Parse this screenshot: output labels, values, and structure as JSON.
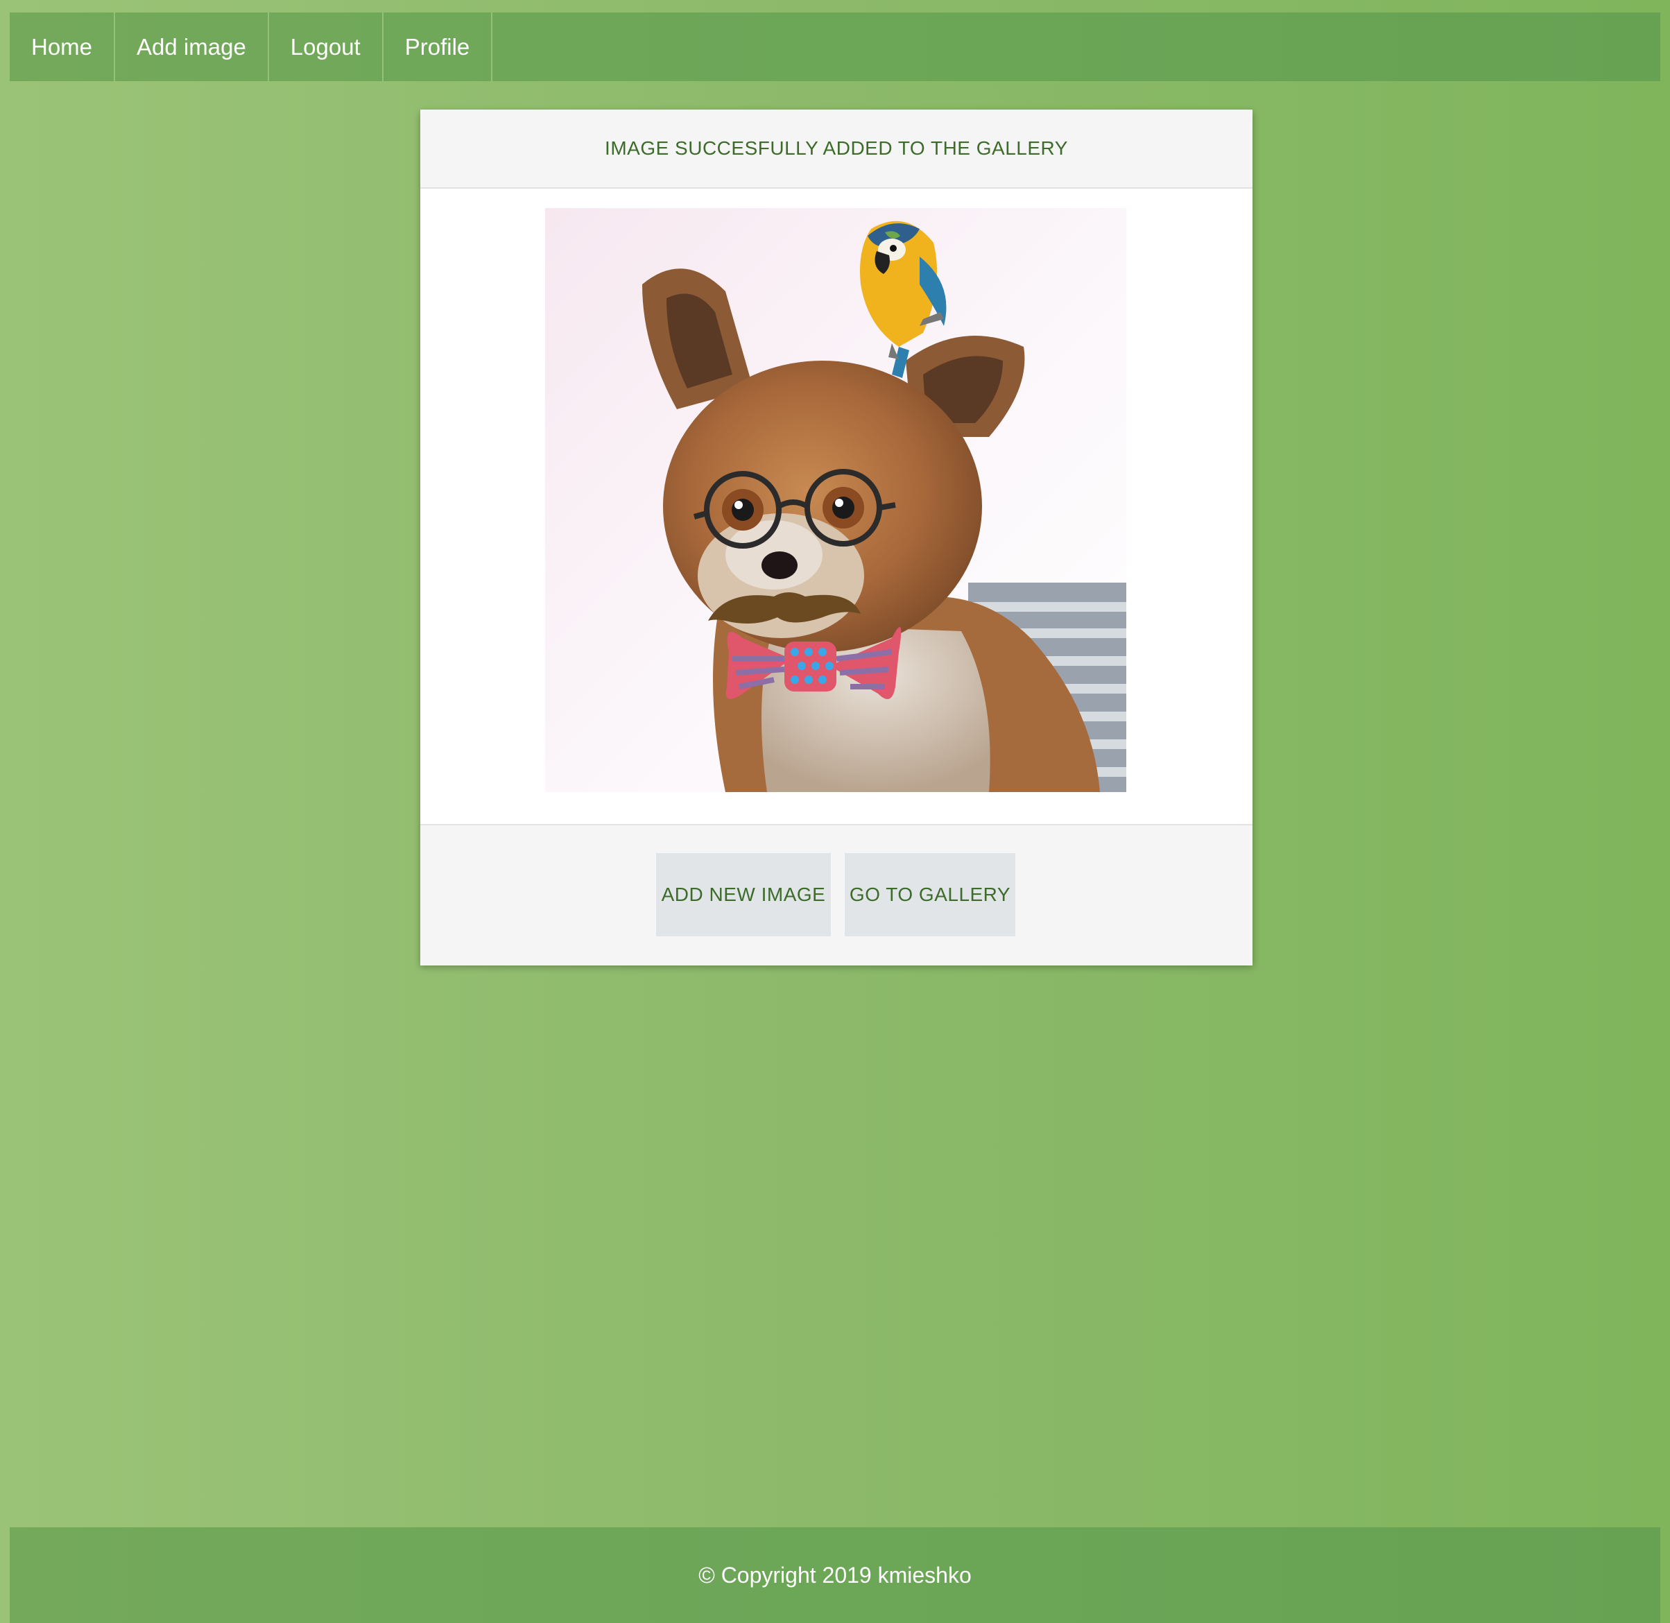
{
  "nav": {
    "items": [
      {
        "label": "Home"
      },
      {
        "label": "Add image"
      },
      {
        "label": "Logout"
      },
      {
        "label": "Profile"
      }
    ]
  },
  "card": {
    "header": "IMAGE SUCCESFULLY ADDED TO THE GALLERY",
    "buttons": {
      "add_new": "ADD NEW IMAGE",
      "gallery": "GO TO GALLERY"
    }
  },
  "footer": {
    "copyright": "© Copyright 2019 kmieshko"
  },
  "colors": {
    "background": "#8dba6b",
    "navbar": "#6ca657",
    "accent_text": "#3c6b2a"
  }
}
